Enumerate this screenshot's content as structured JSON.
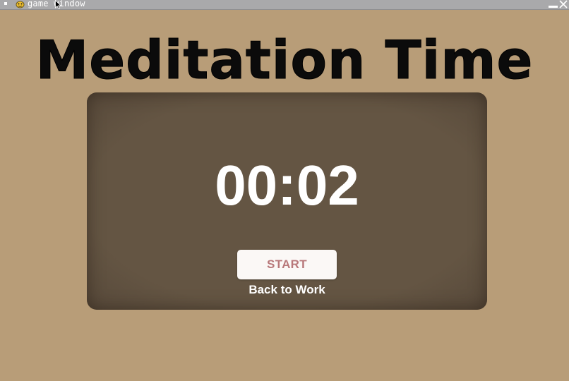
{
  "window": {
    "title": "game window",
    "app_icon": "pygame-snake-icon",
    "menu_icon": "window-menu-icon",
    "minimize_icon": "minimize-icon",
    "close_icon": "close-icon"
  },
  "screen": {
    "title": "Meditation Time",
    "timer": "00:02",
    "start_label": "START",
    "back_label": "Back to Work"
  },
  "colors": {
    "background": "#b89d78",
    "card": "#645543",
    "title_text": "#0b0b0b",
    "timer_text": "#ffffff",
    "button_bg": "#fbf8f6",
    "button_text": "#b8787a",
    "titlebar": "#a9a9ab"
  }
}
